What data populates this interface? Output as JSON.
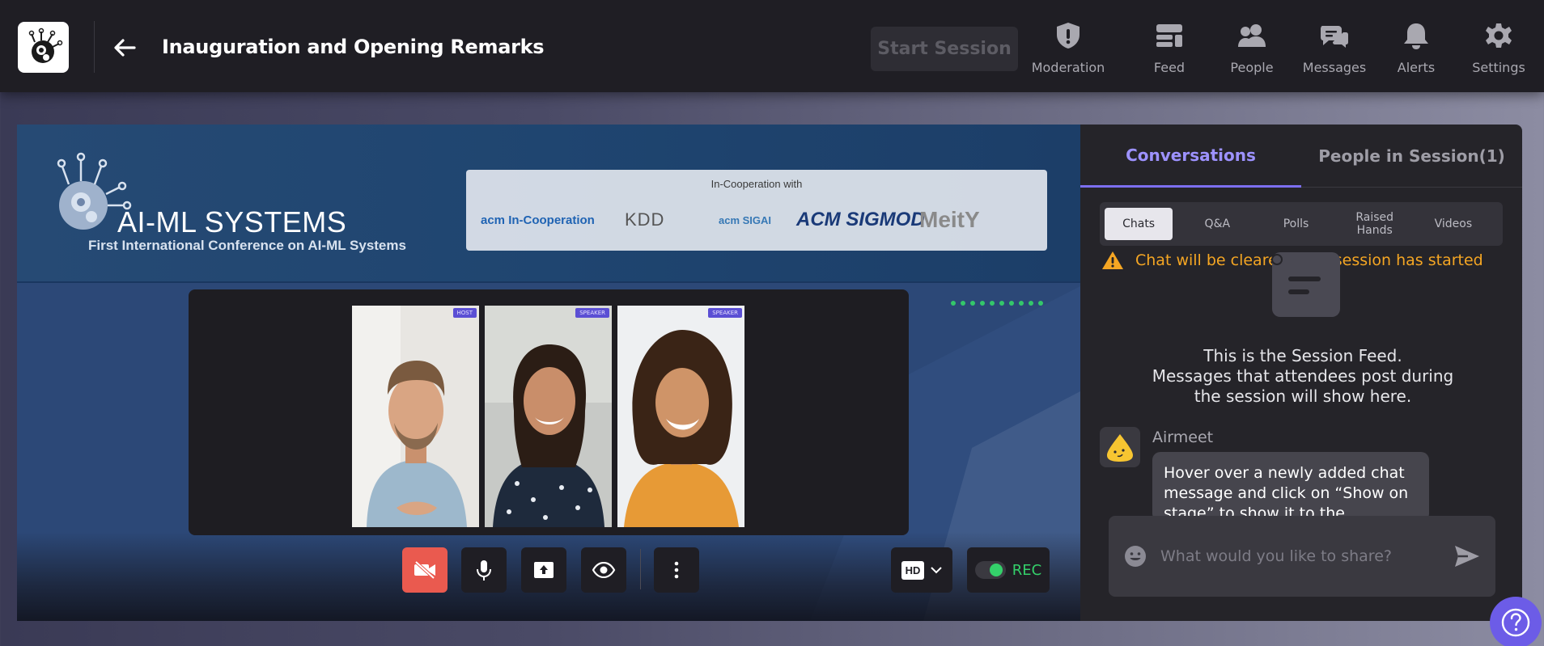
{
  "header": {
    "title": "Inauguration and Opening Remarks",
    "start_session_label": "Start Session",
    "nav": [
      {
        "label": "Moderation",
        "icon": "shield-alert-icon"
      },
      {
        "label": "Feed",
        "icon": "feed-icon"
      },
      {
        "label": "People",
        "icon": "people-icon"
      },
      {
        "label": "Messages",
        "icon": "messages-icon"
      },
      {
        "label": "Alerts",
        "icon": "bell-icon"
      },
      {
        "label": "Settings",
        "icon": "gear-icon"
      }
    ]
  },
  "stage": {
    "banner": {
      "title": "AI-ML SYSTEMS",
      "subtitle": "First International Conference on AI-ML Systems",
      "cooperation_title": "In-Cooperation with",
      "logos": [
        "acm In-Cooperation",
        "KDD",
        "acm SIGAI",
        "ACM SIGMOD",
        "MeitY"
      ]
    },
    "participants": [
      {
        "role": "HOST"
      },
      {
        "role": "SPEAKER"
      },
      {
        "role": "SPEAKER"
      }
    ],
    "controls": {
      "quality_label": "HD",
      "rec_label": "REC"
    }
  },
  "panel": {
    "tabs": {
      "active": "Conversations",
      "inactive": "People in Session(1)"
    },
    "subtabs": [
      "Chats",
      "Q&A",
      "Polls",
      "Raised Hands",
      "Videos"
    ],
    "warning": "Chat will be cleared once session has started",
    "feed_message": [
      "This is the Session Feed.",
      "Messages that attendees post during",
      "the session will show here."
    ],
    "message": {
      "author": "Airmeet",
      "text": "Hover over a newly added chat message and click on “Show on stage” to show it to the audience."
    },
    "composer_placeholder": "What would you like to share?"
  },
  "colors": {
    "accent": "#7d6ff0",
    "warning": "#f5a623",
    "rec_green": "#34d06a",
    "cam_off_red": "#ea5a4f"
  }
}
